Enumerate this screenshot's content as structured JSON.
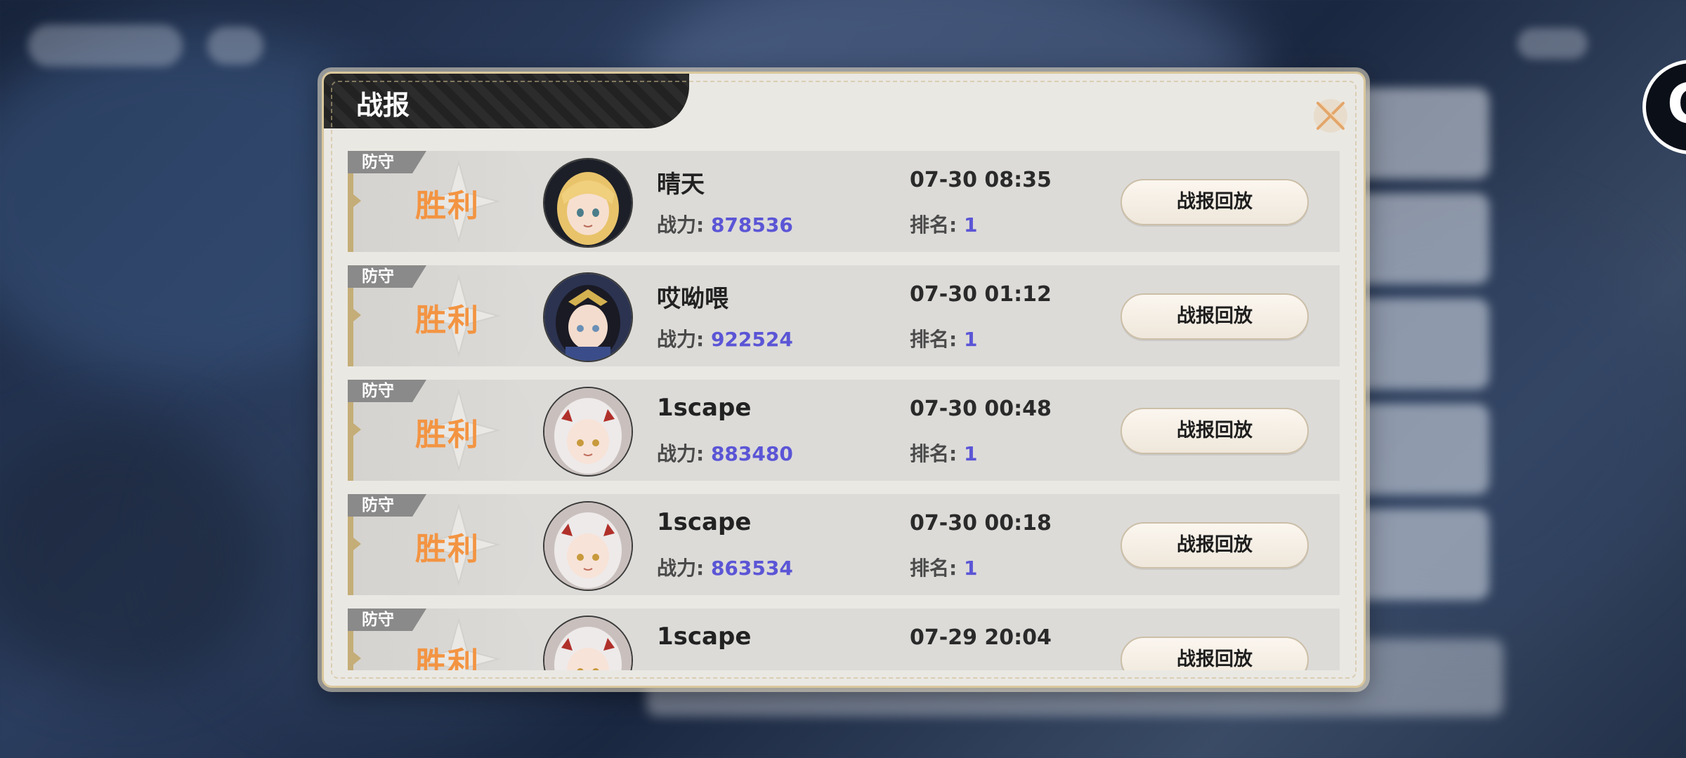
{
  "dialog": {
    "title": "战报",
    "close_icon": "close-x-icon"
  },
  "side_button_letter": "C",
  "colors": {
    "victory": "#f39442",
    "value_blue": "#5b55d6",
    "tag_gray": "#8a8a8a",
    "accent_gold": "#c4ad77"
  },
  "labels": {
    "power": "战力:",
    "rank": "排名:",
    "replay": "战报回放"
  },
  "records": [
    {
      "type": "防守",
      "result": "胜利",
      "name": "晴天",
      "power": "878536",
      "time": "07-30 08:35",
      "rank": "1",
      "avatar": "blonde-girl-avatar"
    },
    {
      "type": "防守",
      "result": "胜利",
      "name": "哎呦喂",
      "power": "922524",
      "time": "07-30 01:12",
      "rank": "1",
      "avatar": "dark-hair-girl-avatar"
    },
    {
      "type": "防守",
      "result": "胜利",
      "name": "1scape",
      "power": "883480",
      "time": "07-30 00:48",
      "rank": "1",
      "avatar": "white-hair-girl-avatar"
    },
    {
      "type": "防守",
      "result": "胜利",
      "name": "1scape",
      "power": "863534",
      "time": "07-30 00:18",
      "rank": "1",
      "avatar": "white-hair-girl-avatar"
    },
    {
      "type": "防守",
      "result": "胜利",
      "name": "1scape",
      "power": "",
      "time": "07-29 20:04",
      "rank": "",
      "avatar": "white-hair-girl-avatar"
    }
  ]
}
